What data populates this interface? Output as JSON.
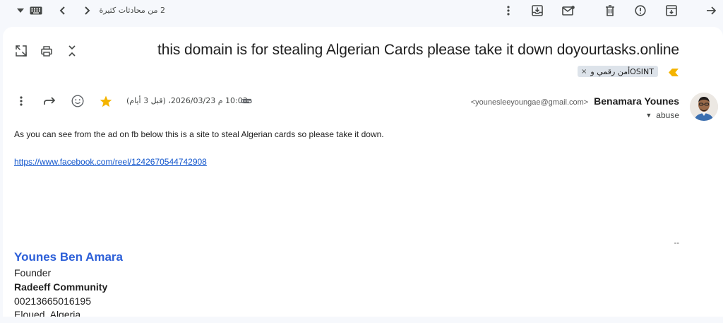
{
  "toolbar": {
    "conversation_counter": "2 من محادثات كثيرة",
    "icons": [
      "dropdown-caret-icon",
      "keyboard-icon",
      "chevron-left-icon",
      "chevron-right-icon",
      "more-vert-icon",
      "move-to-inbox-icon",
      "mark-unread-icon",
      "delete-icon",
      "report-spam-icon",
      "archive-icon",
      "back-arrow-icon"
    ]
  },
  "email": {
    "subject": "this domain is for stealing Algerian Cards please take it down doyourtasks.online",
    "label": "أمن رقمي وOSINT",
    "label_remove": "×",
    "sender_name": "Benamara Younes",
    "sender_email": "<younesleeyoungae@gmail.com>",
    "recipient": "abuse",
    "date": "10:03 م 2026/03/23، (قبل 3 أيام)",
    "body": "As you can see from the ad on fb below this is a site to steal Algerian cards so please take it down.",
    "link": "https://www.facebook.com/reel/1242670544742908"
  },
  "signature": {
    "dash": "--",
    "name": "Younes Ben Amara",
    "role": "Founder",
    "org": "Radeeff Community",
    "phone": "00213665016195",
    "location": "Eloued, Algeria"
  },
  "colors": {
    "background": "#f6f8fc",
    "card": "#ffffff",
    "link": "#1155cc",
    "signature_name": "#2c5fd8",
    "star": "#f4b400",
    "chip": "#dde3ea"
  }
}
